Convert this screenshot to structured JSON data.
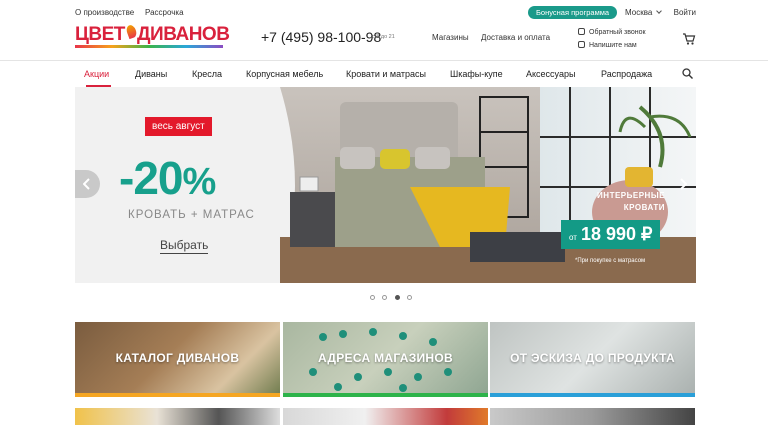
{
  "topbar": {
    "about": "О производстве",
    "installment": "Рассрочка",
    "bonus": "Бонусная программа",
    "city": "Москва",
    "login": "Войти"
  },
  "header": {
    "logo_text_1": "ЦВЕТ",
    "logo_text_2": "ДИВАНОВ",
    "phone": "+7 (495) 98-100-98",
    "hours": "с 8 до 21",
    "stores": "Магазины",
    "delivery": "Доставка и оплата",
    "callback": "Обратный звонок",
    "write_us": "Напишите нам"
  },
  "nav": {
    "items": [
      "Акции",
      "Диваны",
      "Кресла",
      "Корпусная мебель",
      "Кровати и матрасы",
      "Шкафы-купе",
      "Аксессуары",
      "Распродажа"
    ],
    "active": "Акции"
  },
  "hero": {
    "badge": "весь август",
    "discount": "-20",
    "percent": "%",
    "subtitle": "КРОВАТЬ + МАТРАС",
    "cta": "Выбрать",
    "interior_line1": "ИНТЕРЬЕРНЫЕ",
    "interior_line2": "КРОВАТИ",
    "price_prefix": "от",
    "price": "18 990 ₽",
    "footnote": "*При покупке с матрасом",
    "slides": 4,
    "active_slide": 3
  },
  "tiles": [
    {
      "label": "КАТАЛОГ ДИВАНОВ",
      "bar_color": "#f5a623"
    },
    {
      "label": "АДРЕСА МАГАЗИНОВ",
      "bar_color": "#2db34a"
    },
    {
      "label": "ОТ ЭСКИЗА ДО ПРОДУКТА",
      "bar_color": "#2a9fd8"
    }
  ],
  "colors": {
    "brand_red": "#d9213c",
    "accent_teal": "#17a08c"
  }
}
